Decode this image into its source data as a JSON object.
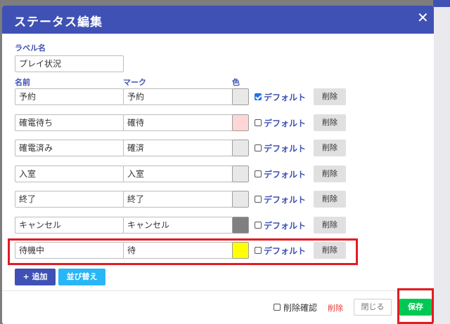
{
  "modal": {
    "title": "ステータス編集",
    "close_glyph": "✕"
  },
  "label_section": {
    "label": "ラベル名",
    "value": "プレイ状況"
  },
  "columns": {
    "name": "名前",
    "mark": "マーク",
    "color": "色"
  },
  "rows": [
    {
      "name": "予約",
      "mark": "予約",
      "color": "#e8e8e8",
      "default_checked": true,
      "default_label": "デフォルト",
      "delete_label": "削除"
    },
    {
      "name": "確電待ち",
      "mark": "確待",
      "color": "#ffd6d6",
      "default_checked": false,
      "default_label": "デフォルト",
      "delete_label": "削除"
    },
    {
      "name": "確電済み",
      "mark": "確済",
      "color": "#e8e8e8",
      "default_checked": false,
      "default_label": "デフォルト",
      "delete_label": "削除"
    },
    {
      "name": "入室",
      "mark": "入室",
      "color": "#e8e8e8",
      "default_checked": false,
      "default_label": "デフォルト",
      "delete_label": "削除"
    },
    {
      "name": "終了",
      "mark": "終了",
      "color": "#e8e8e8",
      "default_checked": false,
      "default_label": "デフォルト",
      "delete_label": "削除"
    },
    {
      "name": "キャンセル",
      "mark": "キャンセル",
      "color": "#808080",
      "default_checked": false,
      "default_label": "デフォルト",
      "delete_label": "削除"
    },
    {
      "name": "待機中",
      "mark": "待",
      "color": "#ffff00",
      "default_checked": false,
      "default_label": "デフォルト",
      "delete_label": "削除"
    }
  ],
  "actions": {
    "add_label": "+ 追加",
    "sort_label": "並び替え"
  },
  "footer": {
    "confirm_delete_label": "削除確認",
    "delete_label": "削除",
    "close_label": "閉じる",
    "save_label": "保存"
  },
  "colors": {
    "primary": "#3f51b5",
    "accent": "#29b6f6",
    "save": "#00c853",
    "danger": "#e53935",
    "highlight": "#e31b23"
  }
}
